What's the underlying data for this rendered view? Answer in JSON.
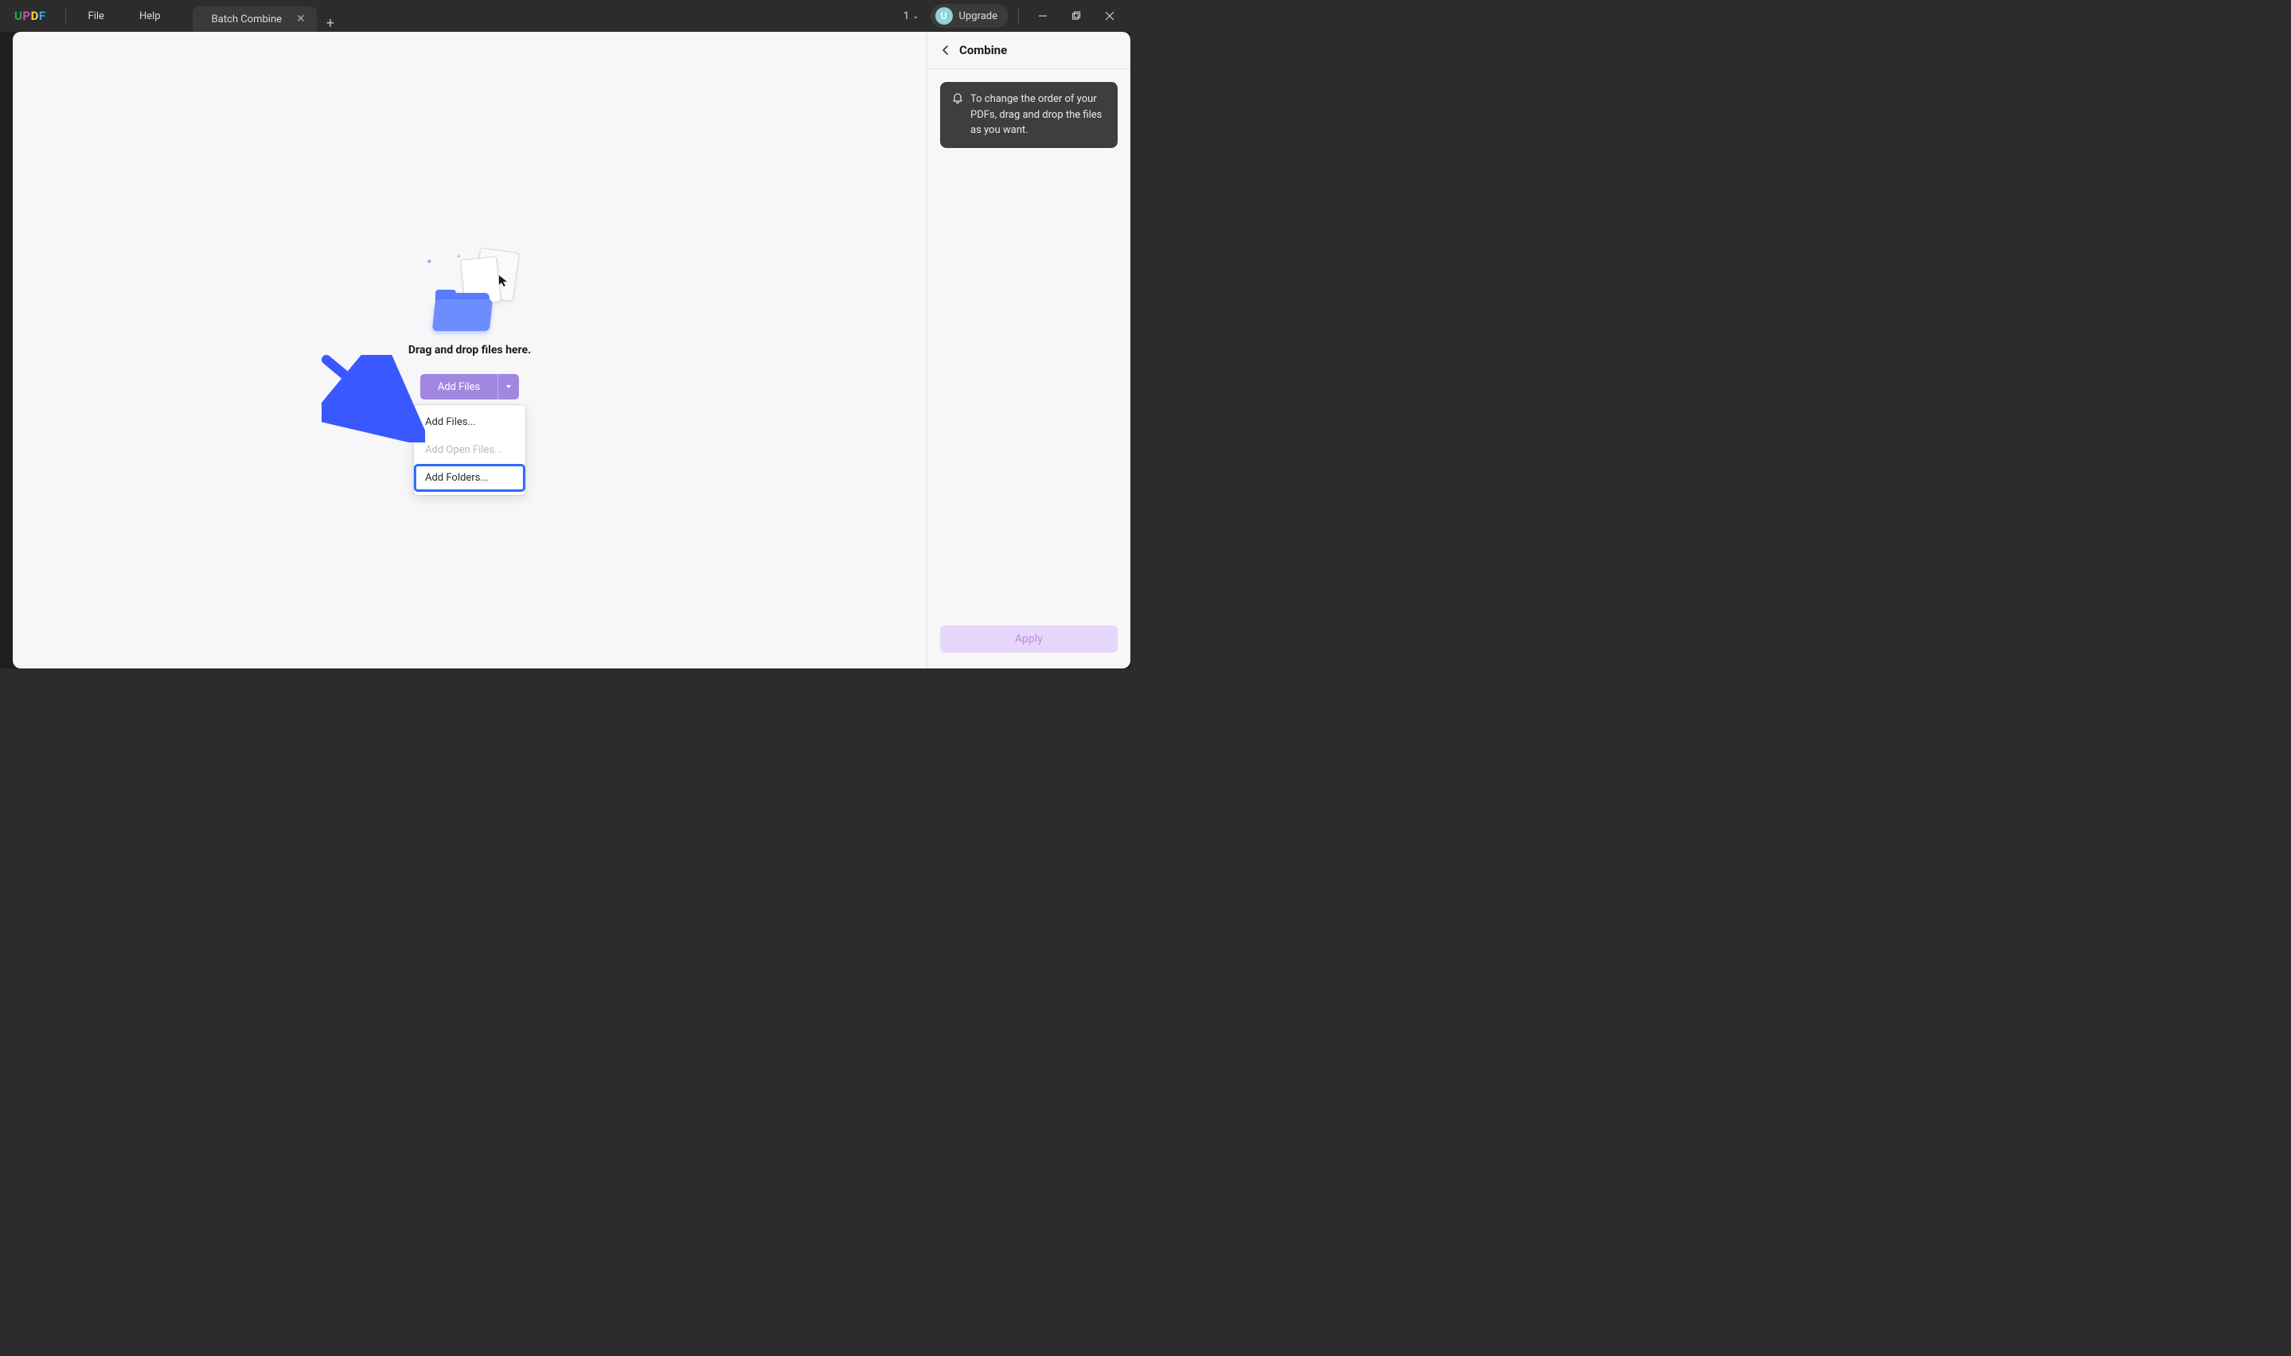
{
  "titlebar": {
    "logo": {
      "u": "U",
      "p": "P",
      "d": "D",
      "f": "F"
    },
    "menu": {
      "file": "File",
      "help": "Help"
    },
    "tab_title": "Batch Combine",
    "count": "1",
    "upgrade": "Upgrade",
    "avatar_initial": "U"
  },
  "main": {
    "drop_text": "Drag and drop files here.",
    "add_files_btn": "Add Files",
    "dropdown": {
      "add_files": "Add Files...",
      "add_open_files": "Add Open Files...",
      "add_folders": "Add Folders..."
    }
  },
  "side": {
    "title": "Combine",
    "tip": "To change the order of your PDFs, drag and drop the files as you want.",
    "apply": "Apply"
  }
}
